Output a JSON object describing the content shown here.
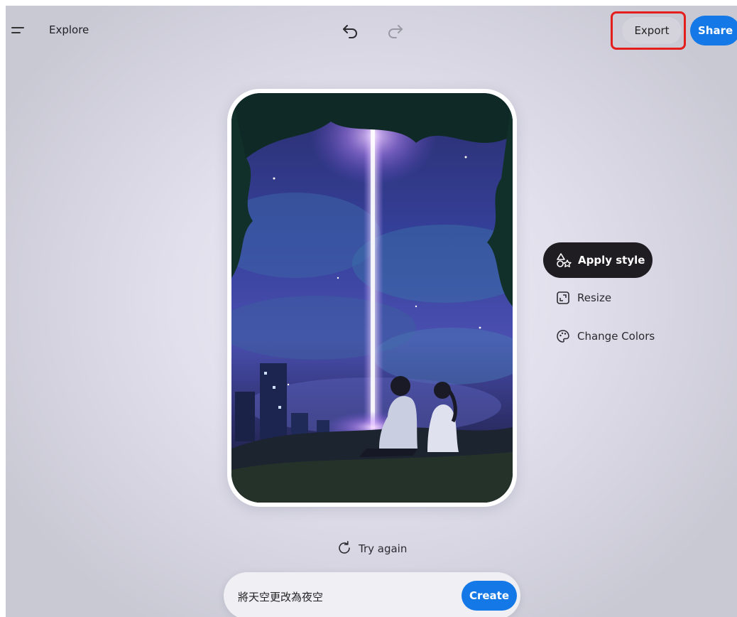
{
  "header": {
    "nav_label": "Explore",
    "export_label": "Export",
    "share_label": "Share"
  },
  "tools": {
    "apply_style": "Apply style",
    "resize": "Resize",
    "change_colors": "Change Colors"
  },
  "actions": {
    "try_again": "Try again"
  },
  "prompt": {
    "value": "將天空更改為夜空",
    "create_label": "Create"
  },
  "colors": {
    "accent": "#1478e6",
    "highlight": "#e41d1d",
    "dark_pill": "#1f1d22"
  },
  "icons": {
    "menu": "hamburger-icon",
    "undo": "undo-icon",
    "redo": "redo-icon",
    "apply_style": "shapes-icon",
    "resize": "resize-icon",
    "change_colors": "palette-icon",
    "try_again": "refresh-icon"
  }
}
